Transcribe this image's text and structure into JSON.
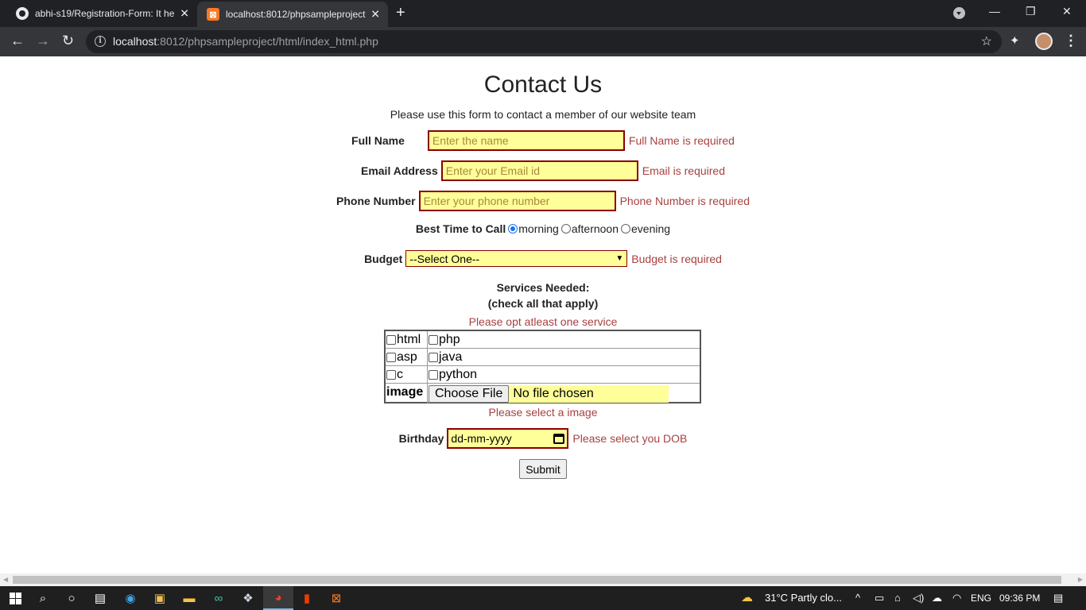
{
  "browser": {
    "tabs": [
      {
        "title": "abhi-s19/Registration-Form: It he",
        "active": false,
        "icon": "github-icon"
      },
      {
        "title": "localhost:8012/phpsampleproject",
        "active": true,
        "icon": "xampp-icon"
      }
    ],
    "tab_close_glyph": "✕",
    "new_tab_glyph": "+",
    "window": {
      "minimize": "—",
      "restore": "❐",
      "close": "✕"
    },
    "nav": {
      "back": "←",
      "forward": "→",
      "reload": "↻"
    },
    "url_host": "localhost",
    "url_rest": ":8012/phpsampleproject/html/index_html.php",
    "info_glyph": "i",
    "star_glyph": "☆",
    "extensions_glyph": "✦",
    "menu_glyph": "⋮"
  },
  "form": {
    "title": "Contact Us",
    "subtitle": "Please use this form to contact a member of our website team",
    "full_name": {
      "label": "Full Name",
      "placeholder": "Enter the name",
      "error": "Full Name is required"
    },
    "email": {
      "label": "Email Address",
      "placeholder": "Enter your Email id",
      "error": "Email is required"
    },
    "phone": {
      "label": "Phone Number",
      "placeholder": "Enter your phone number",
      "error": "Phone Number is required"
    },
    "best_time": {
      "label": "Best Time to Call",
      "options": [
        "morning",
        "afternoon",
        "evening"
      ],
      "selected": "morning"
    },
    "budget": {
      "label": "Budget",
      "selected": "--Select One--",
      "error": "Budget is required"
    },
    "services": {
      "title_line1": "Services Needed:",
      "title_line2": "(check all that apply)",
      "error": "Please opt atleast one service",
      "rows": [
        [
          "html",
          "php"
        ],
        [
          "asp",
          "java"
        ],
        [
          "c",
          "python"
        ]
      ]
    },
    "image": {
      "label": "image",
      "button": "Choose File",
      "status": "No file chosen",
      "error": "Please select a image"
    },
    "birthday": {
      "label": "Birthday",
      "placeholder": "dd-mm-yyyy",
      "error": "Please select you DOB"
    },
    "submit": "Submit"
  },
  "taskbar": {
    "weather": "31°C  Partly clo...",
    "language": "ENG",
    "time": "09:36 PM"
  },
  "colors": {
    "error": "#a84040",
    "input_bg": "#ffff99",
    "input_border": "#8b0000"
  }
}
